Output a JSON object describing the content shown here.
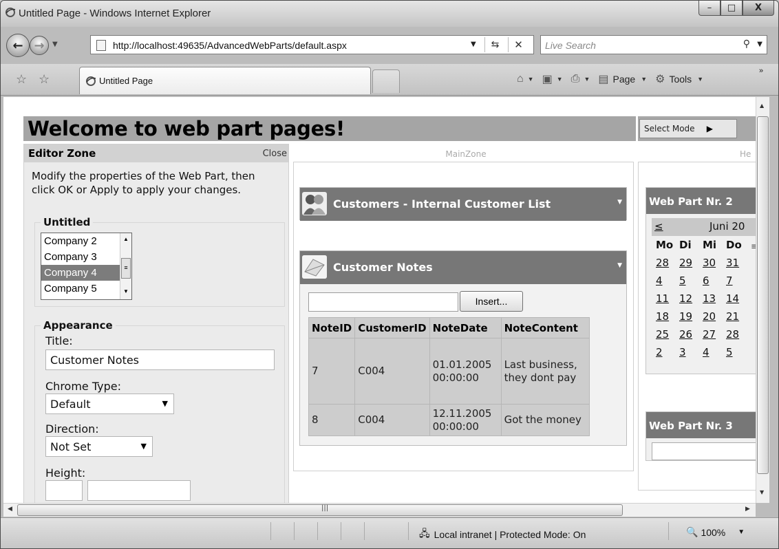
{
  "window": {
    "title": "Untitled Page - Windows Internet Explorer",
    "controls": {
      "minimize": "–",
      "maximize": "□",
      "close": "X"
    }
  },
  "addressbar": {
    "url": "http://localhost:49635/AdvancedWebParts/default.aspx",
    "search_placeholder": "Live Search"
  },
  "tabs": [
    {
      "label": "Untitled Page"
    }
  ],
  "toolbar": {
    "page_label": "Page",
    "tools_label": "Tools",
    "more": "»"
  },
  "page": {
    "heading": "Welcome to web part pages!",
    "select_mode": "Select Mode",
    "editor": {
      "title": "Editor Zone",
      "close": "Close",
      "instructions": "Modify the properties of the Web Part, then click OK or Apply to apply your changes.",
      "untitled_legend": "Untitled",
      "list_items": [
        "Company 2",
        "Company 3",
        "Company 4",
        "Company 5"
      ],
      "selected_item": "Company 4",
      "appearance_legend": "Appearance",
      "title_label": "Title:",
      "title_value": "Customer Notes",
      "chrome_label": "Chrome Type:",
      "chrome_value": "Default",
      "direction_label": "Direction:",
      "direction_value": "Not Set",
      "height_label": "Height:"
    },
    "main_zone": {
      "label": "MainZone",
      "customers_title": "Customers - Internal Customer List",
      "notes_title": "Customer Notes",
      "insert_button": "Insert...",
      "columns": [
        "NoteID",
        "CustomerID",
        "NoteDate",
        "NoteContent"
      ],
      "rows": [
        {
          "NoteID": "7",
          "CustomerID": "C004",
          "NoteDate": "01.01.2005 00:00:00",
          "NoteContent": "Last business, they dont pay"
        },
        {
          "NoteID": "8",
          "CustomerID": "C004",
          "NoteDate": "12.11.2005 00:00:00",
          "NoteContent": "Got the money"
        }
      ]
    },
    "right_zone": {
      "label": "He",
      "wp2_title": "Web Part Nr. 2",
      "calendar_prev": "≤",
      "calendar_month": "Juni 20",
      "day_headers": [
        "Mo",
        "Di",
        "Mi",
        "Do"
      ],
      "weeks": [
        [
          "28",
          "29",
          "30",
          "31"
        ],
        [
          "4",
          "5",
          "6",
          "7"
        ],
        [
          "11",
          "12",
          "13",
          "14"
        ],
        [
          "18",
          "19",
          "20",
          "21"
        ],
        [
          "25",
          "26",
          "27",
          "28"
        ],
        [
          "2",
          "3",
          "4",
          "5"
        ]
      ],
      "wp3_title": "Web Part Nr. 3"
    }
  },
  "statusbar": {
    "zone": "Local intranet | Protected Mode: On",
    "zoom": "100%"
  }
}
